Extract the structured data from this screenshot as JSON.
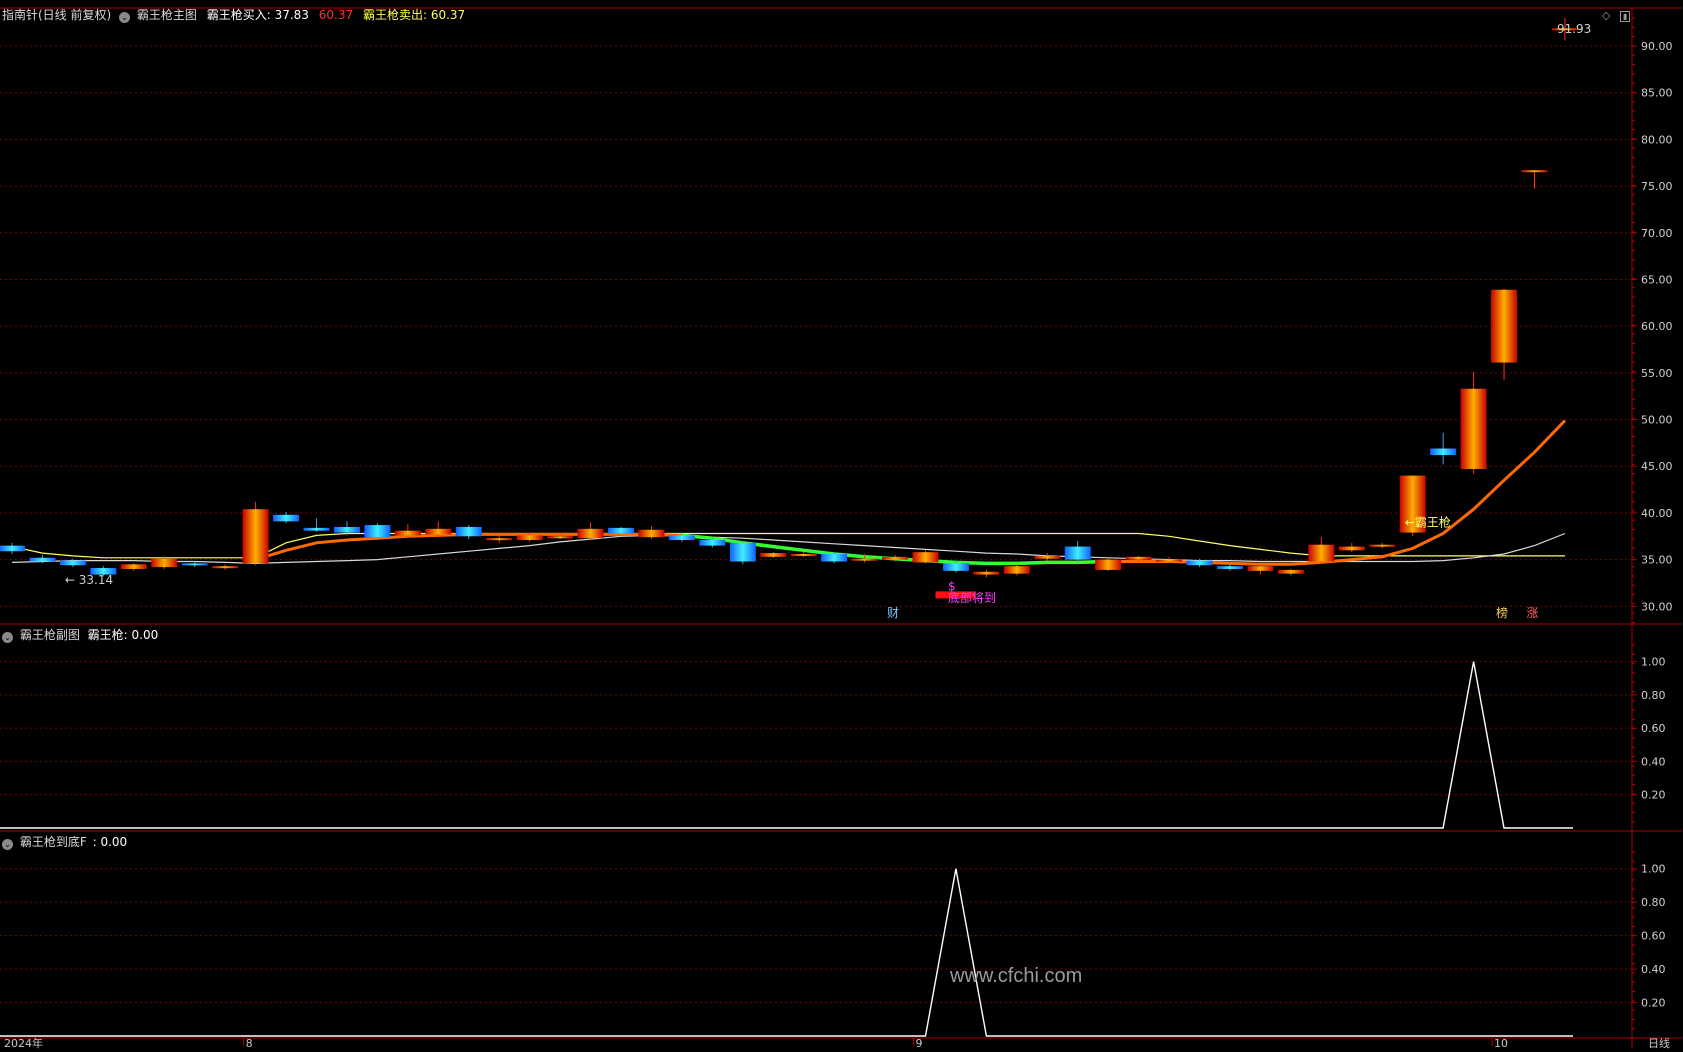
{
  "header": {
    "stock_label": "指南针(日线 前复权)",
    "main_indicator": "霸王枪主图",
    "buy_label": "霸王枪买入:",
    "buy_value": "37.83",
    "mid_value": "60.37",
    "sell_label": "霸王枪卖出:",
    "sell_value": "60.37"
  },
  "sub1": {
    "indicator": "霸王枪副图",
    "label": "霸王枪:",
    "value": "0.00"
  },
  "sub2": {
    "indicator": "霸王枪到底F",
    "label": ":",
    "value": "0.00"
  },
  "footer": {
    "year_label": "2024年",
    "corner_label": "日线"
  },
  "watermark": "www.cfchi.com",
  "colors": {
    "up": "#ff2a1a",
    "down": "#19b4ff",
    "grid": "#7a0000",
    "axis": "#b00000",
    "long_line": "#ffff66",
    "fast_line": "#ff6a00",
    "slow_line": "#d8d8d8"
  },
  "chart_data": [
    {
      "type": "candlestick",
      "ylim": [
        28,
        93
      ],
      "yticks": [
        "90.00",
        "85.00",
        "80.00",
        "75.00",
        "70.00",
        "65.00",
        "60.00",
        "55.00",
        "50.00",
        "45.00",
        "40.00",
        "35.00",
        "30.00"
      ],
      "x_labels": [
        {
          "label": "8",
          "index": 8
        },
        {
          "label": "9",
          "index": 30
        },
        {
          "label": "10",
          "index": 49
        }
      ],
      "ohlc": [
        [
          36.5,
          36.8,
          35.6,
          35.9
        ],
        [
          35.2,
          35.5,
          34.6,
          34.8
        ],
        [
          34.9,
          35.1,
          34.2,
          34.4
        ],
        [
          34.1,
          34.3,
          33.2,
          33.4
        ],
        [
          34.0,
          34.6,
          33.8,
          34.5
        ],
        [
          34.2,
          35.4,
          34.0,
          35.1
        ],
        [
          34.6,
          34.8,
          34.2,
          34.4
        ],
        [
          34.2,
          34.5,
          33.9,
          34.3
        ],
        [
          34.6,
          41.2,
          34.4,
          40.4
        ],
        [
          39.8,
          40.1,
          38.9,
          39.1
        ],
        [
          38.4,
          39.4,
          38.0,
          38.1
        ],
        [
          38.5,
          39.1,
          37.6,
          37.9
        ],
        [
          38.7,
          38.9,
          37.1,
          37.4
        ],
        [
          37.6,
          38.8,
          37.4,
          38.1
        ],
        [
          37.7,
          39.1,
          37.5,
          38.3
        ],
        [
          38.5,
          38.7,
          37.2,
          37.5
        ],
        [
          37.1,
          37.6,
          36.8,
          37.3
        ],
        [
          37.1,
          37.9,
          36.9,
          37.6
        ],
        [
          37.4,
          37.8,
          37.2,
          37.5
        ],
        [
          37.3,
          39.0,
          37.1,
          38.3
        ],
        [
          38.4,
          38.5,
          37.6,
          37.8
        ],
        [
          37.4,
          38.6,
          37.2,
          38.2
        ],
        [
          37.6,
          37.9,
          36.9,
          37.1
        ],
        [
          37.1,
          37.4,
          36.3,
          36.5
        ],
        [
          36.8,
          37.0,
          34.5,
          34.8
        ],
        [
          35.3,
          35.8,
          35.2,
          35.7
        ],
        [
          35.5,
          35.8,
          35.3,
          35.6
        ],
        [
          35.6,
          35.8,
          34.6,
          34.8
        ],
        [
          34.9,
          35.6,
          34.7,
          35.1
        ],
        [
          35.0,
          35.5,
          34.8,
          35.3
        ],
        [
          34.7,
          36.0,
          34.6,
          35.8
        ],
        [
          34.6,
          34.9,
          33.6,
          33.8
        ],
        [
          33.4,
          33.9,
          33.1,
          33.7
        ],
        [
          33.5,
          34.5,
          33.3,
          34.3
        ],
        [
          35.1,
          35.7,
          34.9,
          35.4
        ],
        [
          36.4,
          37.0,
          34.7,
          35.0
        ],
        [
          33.9,
          35.1,
          33.8,
          35.0
        ],
        [
          35.0,
          35.4,
          34.8,
          35.3
        ],
        [
          34.8,
          35.3,
          34.6,
          35.0
        ],
        [
          34.9,
          35.1,
          34.2,
          34.4
        ],
        [
          34.3,
          34.6,
          33.8,
          34.0
        ],
        [
          33.8,
          34.5,
          33.4,
          34.3
        ],
        [
          33.5,
          34.0,
          33.3,
          33.9
        ],
        [
          34.8,
          37.4,
          34.6,
          36.6
        ],
        [
          36.0,
          36.8,
          35.8,
          36.4
        ],
        [
          36.4,
          36.8,
          36.2,
          36.6
        ],
        [
          37.9,
          44.0,
          37.5,
          44.0
        ],
        [
          46.9,
          48.6,
          45.2,
          46.2
        ],
        [
          44.7,
          55.1,
          44.2,
          53.3
        ],
        [
          56.1,
          64.0,
          54.2,
          63.9
        ],
        [
          76.7,
          76.7,
          74.7,
          76.7
        ],
        [
          91.9,
          93.0,
          90.6,
          91.9
        ]
      ],
      "series": [
        {
          "values": [
            36.4,
            35.7,
            35.4,
            35.2,
            35.2,
            35.2,
            35.2,
            35.2,
            35.2,
            36.8,
            37.6,
            37.8,
            37.8,
            37.8,
            37.8,
            37.8,
            37.8,
            37.8,
            37.8,
            37.8,
            37.8,
            37.8,
            37.8,
            37.8,
            37.8,
            37.8,
            37.8,
            37.8,
            37.8,
            37.8,
            37.8,
            37.8,
            37.8,
            37.8,
            37.8,
            37.8,
            37.8,
            37.8,
            37.5,
            37.0,
            36.5,
            36.1,
            35.7,
            35.4,
            35.4,
            35.4,
            35.4,
            35.4,
            35.4,
            35.4,
            35.4,
            35.4
          ]
        },
        {
          "values": [
            34.7,
            34.8,
            34.9,
            34.9,
            34.9,
            34.8,
            34.8,
            34.7,
            34.6,
            34.7,
            34.8,
            34.9,
            35.0,
            35.3,
            35.6,
            35.9,
            36.2,
            36.5,
            36.9,
            37.2,
            37.5,
            37.6,
            37.5,
            37.4,
            37.3,
            37.1,
            36.9,
            36.7,
            36.5,
            36.3,
            36.1,
            35.9,
            35.7,
            35.6,
            35.4,
            35.3,
            35.2,
            35.1,
            35.0,
            34.9,
            34.9,
            34.8,
            34.8,
            34.8,
            34.8,
            34.8,
            34.8,
            34.9,
            35.2,
            35.6,
            36.5,
            37.8
          ]
        },
        {
          "values": [
            null,
            null,
            null,
            null,
            null,
            null,
            null,
            null,
            35.0,
            36.0,
            36.8,
            37.1,
            37.3,
            37.5,
            37.6,
            37.7,
            37.7,
            37.7,
            37.7,
            37.7,
            37.7,
            37.7,
            37.6,
            37.3,
            36.8,
            36.4,
            36.0,
            35.6,
            35.3,
            35.1,
            34.9,
            34.7,
            34.6,
            34.6,
            34.7,
            34.7,
            34.8,
            34.8,
            34.8,
            34.7,
            34.6,
            34.5,
            34.5,
            34.7,
            35.0,
            35.3,
            36.2,
            37.8,
            40.4,
            43.5,
            46.5,
            49.9
          ]
        }
      ],
      "annotations": [
        {
          "text": "← 33.14",
          "index": 2,
          "value": 32.8,
          "color": "#d0d0d0"
        },
        {
          "text": "←霸王枪",
          "index": 46,
          "value": 39.0,
          "color": "#ffff66"
        },
        {
          "text": "底部将到",
          "index": 31,
          "value": 30.9,
          "color": "#ff40ff"
        },
        {
          "text": "$",
          "index": 31,
          "value": 32.1,
          "color": "#ff40ff"
        },
        {
          "text": "91.93",
          "index": 51,
          "value": 91.8,
          "color": "#d0d0d0"
        },
        {
          "text": "财",
          "index": 29,
          "value": 29.3,
          "color": "#7fc4ff"
        },
        {
          "text": "榜",
          "index": 49,
          "value": 29.3,
          "color": "#ffcc66"
        },
        {
          "text": "涨",
          "index": 50,
          "value": 29.3,
          "color": "#ff6666"
        }
      ]
    },
    {
      "type": "line",
      "ylim": [
        0,
        1.1
      ],
      "yticks": [
        "1.00",
        "0.80",
        "0.60",
        "0.40",
        "0.20"
      ],
      "values": [
        0,
        0,
        0,
        0,
        0,
        0,
        0,
        0,
        0,
        0,
        0,
        0,
        0,
        0,
        0,
        0,
        0,
        0,
        0,
        0,
        0,
        0,
        0,
        0,
        0,
        0,
        0,
        0,
        0,
        0,
        0,
        0,
        0,
        0,
        0,
        0,
        0,
        0,
        0,
        0,
        0,
        0,
        0,
        0,
        0,
        0,
        0,
        0,
        1,
        0,
        0,
        0
      ]
    },
    {
      "type": "line",
      "ylim": [
        0,
        1.1
      ],
      "yticks": [
        "1.00",
        "0.80",
        "0.60",
        "0.40",
        "0.20"
      ],
      "values": [
        0,
        0,
        0,
        0,
        0,
        0,
        0,
        0,
        0,
        0,
        0,
        0,
        0,
        0,
        0,
        0,
        0,
        0,
        0,
        0,
        0,
        0,
        0,
        0,
        0,
        0,
        0,
        0,
        0,
        0,
        0,
        1,
        0,
        0,
        0,
        0,
        0,
        0,
        0,
        0,
        0,
        0,
        0,
        0,
        0,
        0,
        0,
        0,
        0,
        0,
        0,
        0
      ]
    }
  ]
}
